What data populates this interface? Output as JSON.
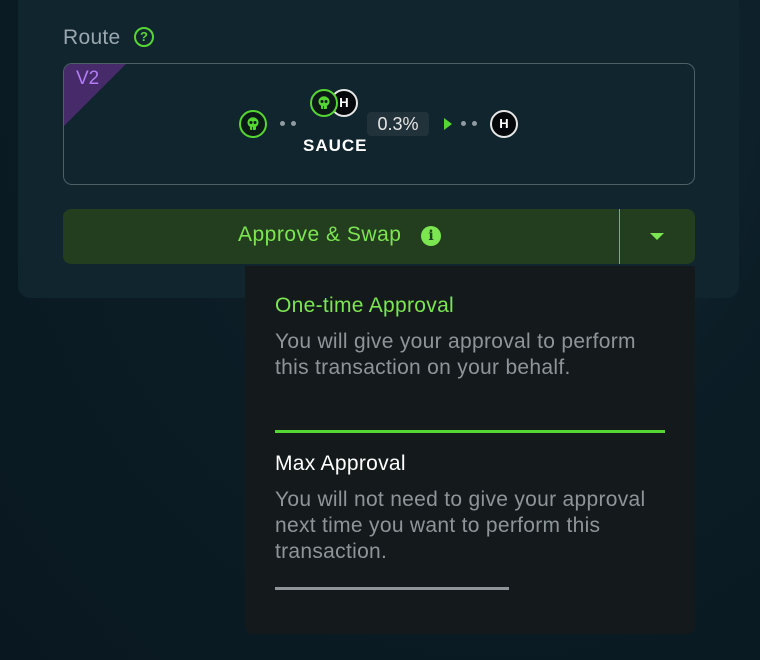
{
  "route": {
    "label": "Route",
    "version_badge": "V2",
    "pool_token": "SAUCE",
    "fee": "0.3%",
    "tokens": {
      "from_icon": "skull-icon",
      "pair_icons": [
        "skull-icon",
        "hbar-h-icon"
      ],
      "to_icon": "hbar-h-icon",
      "h_letter": "H"
    }
  },
  "swap_button": {
    "label": "Approve & Swap",
    "info_glyph": "i"
  },
  "approval_menu": {
    "options": [
      {
        "title": "One-time Approval",
        "description": "You will give your approval to perform this transaction on your behalf.",
        "selected": true
      },
      {
        "title": "Max Approval",
        "description": "You will not need to give your approval next time you want to perform this transaction.",
        "selected": false
      }
    ]
  },
  "colors": {
    "accent_green": "#7ce552",
    "button_bg": "#233e1e",
    "badge_purple": "#462a6a",
    "badge_text": "#b27cf6"
  }
}
